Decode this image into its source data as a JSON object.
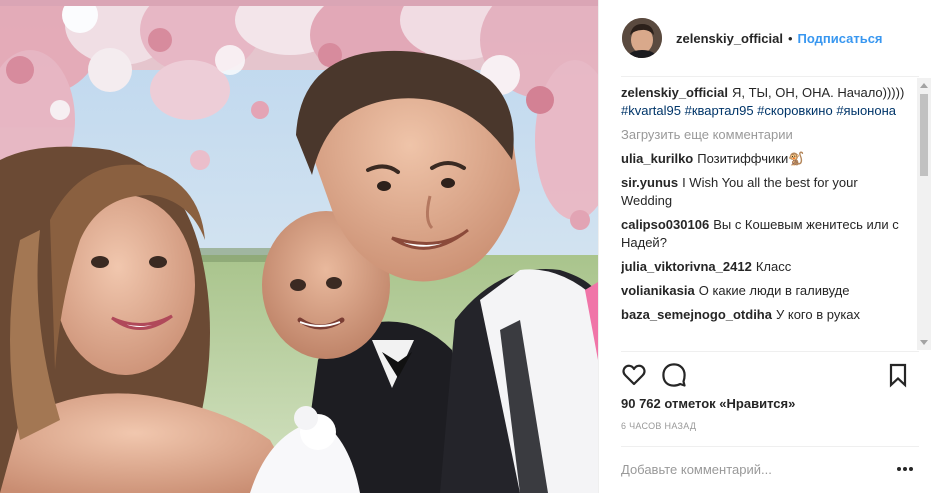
{
  "post": {
    "username": "zelenskiy_official",
    "separator": "•",
    "follow_label": "Подписаться"
  },
  "comments": {
    "caption": {
      "user": "zelenskiy_official",
      "text": "Я, ТЫ, ОН, ОНА. Начало)))))",
      "tags": [
        "#kvartal95",
        "#квартал95",
        "#скоровкино",
        "#яыонона"
      ]
    },
    "load_more": "Загрузить еще комментарии",
    "items": [
      {
        "user": "ulia_kurilko",
        "text": "Позитиффчики🐒"
      },
      {
        "user": "sir.yunus",
        "text": "I Wish You all the best for your Wedding"
      },
      {
        "user": "calipso030106",
        "text": "Вы с Кошевым женитесь или с Надей?"
      },
      {
        "user": "julia_viktorivna_2412",
        "text": "Класс"
      },
      {
        "user": "volianikasia",
        "text": "О какие люди в галивуде"
      },
      {
        "user": "baza_semejnogo_otdiha",
        "text": "У кого в руках"
      }
    ]
  },
  "actions": {
    "like_icon": "heart-icon",
    "comment_icon": "comment-icon",
    "save_icon": "bookmark-icon"
  },
  "likes": {
    "count": "90 762",
    "label": "отметок «Нравится»"
  },
  "timestamp": "6 часов назад",
  "add_comment": {
    "placeholder": "Добавьте комментарий..."
  },
  "colors": {
    "accent": "#3897f0",
    "hashtag": "#003569",
    "muted": "#999999",
    "text": "#262626"
  }
}
